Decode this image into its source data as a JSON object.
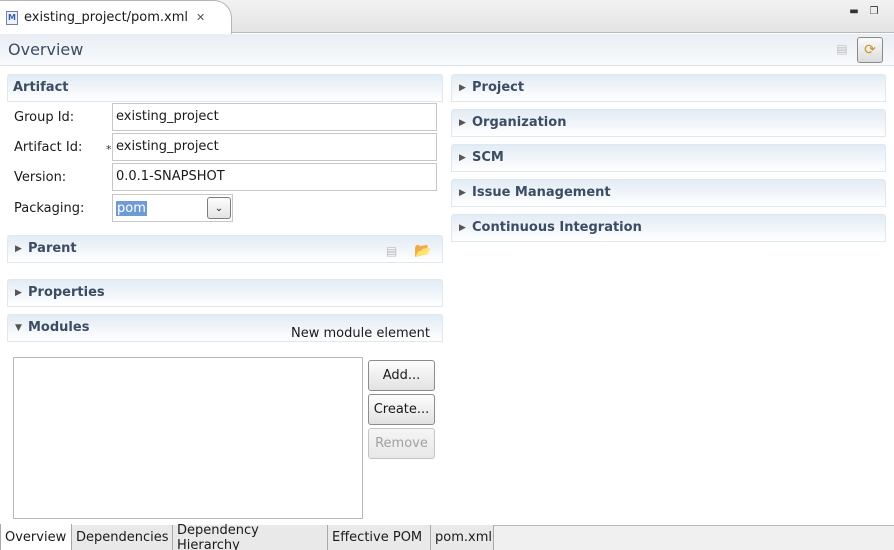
{
  "editor_tab": {
    "title": "existing_project/pom.xml",
    "icon_letter": "M"
  },
  "window_buttons": {
    "minimize": "▬",
    "restore": "❐"
  },
  "form_title": "Overview",
  "artifact": {
    "title": "Artifact",
    "group_id_label": "Group Id:",
    "group_id_value": "existing_project",
    "artifact_id_label": "Artifact Id:",
    "artifact_id_required": "*",
    "artifact_id_value": "existing_project",
    "version_label": "Version:",
    "version_value": "0.0.1-SNAPSHOT",
    "packaging_label": "Packaging:",
    "packaging_value": "pom"
  },
  "parent": {
    "title": "Parent"
  },
  "properties": {
    "title": "Properties"
  },
  "modules": {
    "title": "Modules",
    "new_module_label": "New module element",
    "add_label": "Add...",
    "create_label": "Create...",
    "remove_label": "Remove"
  },
  "right_sections": [
    "Project",
    "Organization",
    "SCM",
    "Issue Management",
    "Continuous Integration"
  ],
  "bottom_tabs": [
    "Overview",
    "Dependencies",
    "Dependency Hierarchy",
    "Effective POM",
    "pom.xml"
  ],
  "active_bottom_tab": "Overview",
  "icons": {
    "file": "maven-pom-file-icon",
    "close": "close-icon",
    "collapsed": "triangle-right-icon",
    "expanded": "triangle-down-icon",
    "dropdown": "chevron-down-icon",
    "open": "folder-open-icon",
    "select": "select-pom-icon",
    "refresh": "refresh-icon"
  },
  "colors": {
    "section_title": "#3b4c63",
    "selection": "#6e9bd3",
    "accent_icon": "#c9961f"
  }
}
